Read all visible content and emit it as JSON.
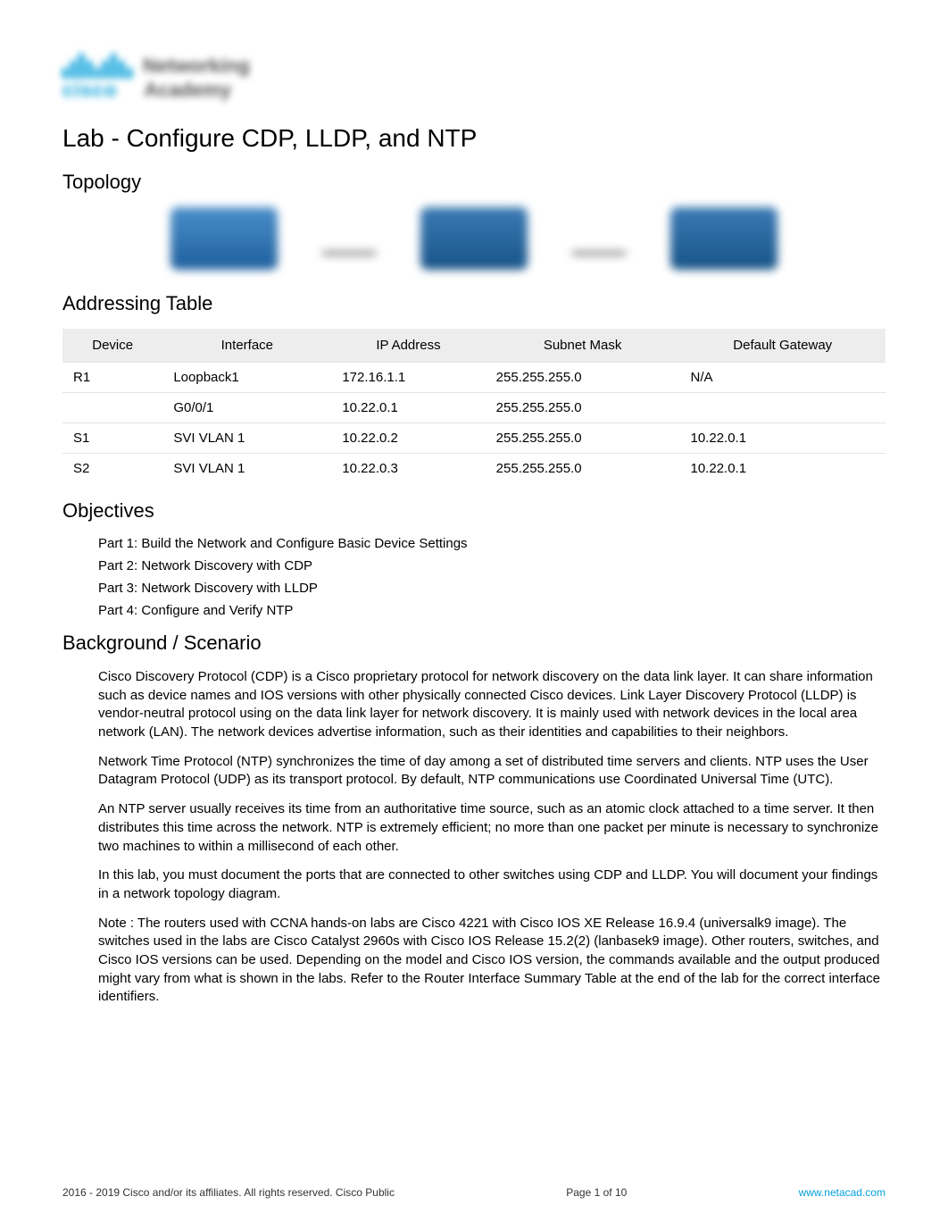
{
  "logo": {
    "cisco": "cisco",
    "networking": "Networking",
    "academy": "Academy"
  },
  "title": "Lab - Configure CDP, LLDP, and NTP",
  "sections": {
    "topology": "Topology",
    "addressing": "Addressing Table",
    "objectives": "Objectives",
    "background": "Background / Scenario"
  },
  "addr_table": {
    "headers": {
      "device": "Device",
      "interface": "Interface",
      "ip": "IP Address",
      "mask": "Subnet Mask",
      "gateway": "Default Gateway"
    },
    "rows": [
      {
        "device": "R1",
        "interface": "Loopback1",
        "ip": "172.16.1.1",
        "mask": "255.255.255.0",
        "gateway": "N/A"
      },
      {
        "device": "",
        "interface": "G0/0/1",
        "ip": "10.22.0.1",
        "mask": "255.255.255.0",
        "gateway": ""
      },
      {
        "device": "S1",
        "interface": "SVI VLAN 1",
        "ip": "10.22.0.2",
        "mask": "255.255.255.0",
        "gateway": "10.22.0.1"
      },
      {
        "device": "S2",
        "interface": "SVI VLAN 1",
        "ip": "10.22.0.3",
        "mask": "255.255.255.0",
        "gateway": "10.22.0.1"
      }
    ]
  },
  "objectives": [
    "Part 1: Build the Network and Configure Basic Device Settings",
    "Part 2: Network Discovery with CDP",
    "Part 3: Network Discovery with LLDP",
    "Part 4: Configure and Verify NTP"
  ],
  "background_paras": [
    "Cisco Discovery Protocol (CDP) is a Cisco proprietary protocol for network discovery on the data link layer. It can share information such as device names and IOS versions with other physically connected Cisco devices. Link Layer Discovery Protocol (LLDP) is vendor-neutral protocol using on the data link layer for network discovery. It is mainly used with network devices in the local area network (LAN). The network devices advertise information, such as their identities and capabilities to their neighbors.",
    "Network Time Protocol (NTP) synchronizes the time of day among a set of distributed time servers and clients. NTP uses the User Datagram Protocol (UDP) as its transport protocol. By default, NTP communications use Coordinated Universal Time (UTC).",
    "An NTP server usually receives its time from an authoritative time source, such as an atomic clock attached to a time server. It then distributes this time across the network. NTP is extremely efficient; no more than one packet per minute is necessary to synchronize two machines to within a millisecond of each other.",
    "In this lab, you must document the ports that are connected to other switches using CDP and LLDP. You will document your findings in a network topology diagram.",
    "Note : The routers used with CCNA hands-on labs are Cisco 4221 with Cisco IOS XE Release 16.9.4 (universalk9 image). The switches used in the labs are Cisco Catalyst 2960s with Cisco IOS Release 15.2(2) (lanbasek9 image). Other routers, switches, and Cisco IOS versions can be used. Depending on the model and Cisco IOS version, the commands available and the output produced might vary from what is shown in the labs. Refer to the Router Interface Summary Table at the end of the lab for the correct interface identifiers."
  ],
  "footer": {
    "copyright": " 2016 - 2019 Cisco and/or its affiliates. All rights reserved. Cisco Public",
    "page": "Page  1 of 10",
    "link": "www.netacad.com"
  }
}
